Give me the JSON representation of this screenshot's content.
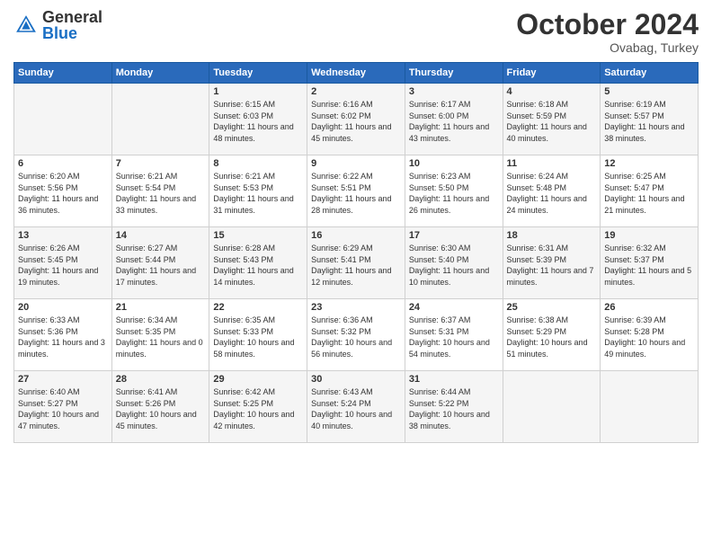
{
  "header": {
    "logo": "GeneralBlue",
    "month": "October 2024",
    "location": "Ovabag, Turkey"
  },
  "weekdays": [
    "Sunday",
    "Monday",
    "Tuesday",
    "Wednesday",
    "Thursday",
    "Friday",
    "Saturday"
  ],
  "weeks": [
    [
      {
        "day": "",
        "sunrise": "",
        "sunset": "",
        "daylight": ""
      },
      {
        "day": "",
        "sunrise": "",
        "sunset": "",
        "daylight": ""
      },
      {
        "day": "1",
        "sunrise": "Sunrise: 6:15 AM",
        "sunset": "Sunset: 6:03 PM",
        "daylight": "Daylight: 11 hours and 48 minutes."
      },
      {
        "day": "2",
        "sunrise": "Sunrise: 6:16 AM",
        "sunset": "Sunset: 6:02 PM",
        "daylight": "Daylight: 11 hours and 45 minutes."
      },
      {
        "day": "3",
        "sunrise": "Sunrise: 6:17 AM",
        "sunset": "Sunset: 6:00 PM",
        "daylight": "Daylight: 11 hours and 43 minutes."
      },
      {
        "day": "4",
        "sunrise": "Sunrise: 6:18 AM",
        "sunset": "Sunset: 5:59 PM",
        "daylight": "Daylight: 11 hours and 40 minutes."
      },
      {
        "day": "5",
        "sunrise": "Sunrise: 6:19 AM",
        "sunset": "Sunset: 5:57 PM",
        "daylight": "Daylight: 11 hours and 38 minutes."
      }
    ],
    [
      {
        "day": "6",
        "sunrise": "Sunrise: 6:20 AM",
        "sunset": "Sunset: 5:56 PM",
        "daylight": "Daylight: 11 hours and 36 minutes."
      },
      {
        "day": "7",
        "sunrise": "Sunrise: 6:21 AM",
        "sunset": "Sunset: 5:54 PM",
        "daylight": "Daylight: 11 hours and 33 minutes."
      },
      {
        "day": "8",
        "sunrise": "Sunrise: 6:21 AM",
        "sunset": "Sunset: 5:53 PM",
        "daylight": "Daylight: 11 hours and 31 minutes."
      },
      {
        "day": "9",
        "sunrise": "Sunrise: 6:22 AM",
        "sunset": "Sunset: 5:51 PM",
        "daylight": "Daylight: 11 hours and 28 minutes."
      },
      {
        "day": "10",
        "sunrise": "Sunrise: 6:23 AM",
        "sunset": "Sunset: 5:50 PM",
        "daylight": "Daylight: 11 hours and 26 minutes."
      },
      {
        "day": "11",
        "sunrise": "Sunrise: 6:24 AM",
        "sunset": "Sunset: 5:48 PM",
        "daylight": "Daylight: 11 hours and 24 minutes."
      },
      {
        "day": "12",
        "sunrise": "Sunrise: 6:25 AM",
        "sunset": "Sunset: 5:47 PM",
        "daylight": "Daylight: 11 hours and 21 minutes."
      }
    ],
    [
      {
        "day": "13",
        "sunrise": "Sunrise: 6:26 AM",
        "sunset": "Sunset: 5:45 PM",
        "daylight": "Daylight: 11 hours and 19 minutes."
      },
      {
        "day": "14",
        "sunrise": "Sunrise: 6:27 AM",
        "sunset": "Sunset: 5:44 PM",
        "daylight": "Daylight: 11 hours and 17 minutes."
      },
      {
        "day": "15",
        "sunrise": "Sunrise: 6:28 AM",
        "sunset": "Sunset: 5:43 PM",
        "daylight": "Daylight: 11 hours and 14 minutes."
      },
      {
        "day": "16",
        "sunrise": "Sunrise: 6:29 AM",
        "sunset": "Sunset: 5:41 PM",
        "daylight": "Daylight: 11 hours and 12 minutes."
      },
      {
        "day": "17",
        "sunrise": "Sunrise: 6:30 AM",
        "sunset": "Sunset: 5:40 PM",
        "daylight": "Daylight: 11 hours and 10 minutes."
      },
      {
        "day": "18",
        "sunrise": "Sunrise: 6:31 AM",
        "sunset": "Sunset: 5:39 PM",
        "daylight": "Daylight: 11 hours and 7 minutes."
      },
      {
        "day": "19",
        "sunrise": "Sunrise: 6:32 AM",
        "sunset": "Sunset: 5:37 PM",
        "daylight": "Daylight: 11 hours and 5 minutes."
      }
    ],
    [
      {
        "day": "20",
        "sunrise": "Sunrise: 6:33 AM",
        "sunset": "Sunset: 5:36 PM",
        "daylight": "Daylight: 11 hours and 3 minutes."
      },
      {
        "day": "21",
        "sunrise": "Sunrise: 6:34 AM",
        "sunset": "Sunset: 5:35 PM",
        "daylight": "Daylight: 11 hours and 0 minutes."
      },
      {
        "day": "22",
        "sunrise": "Sunrise: 6:35 AM",
        "sunset": "Sunset: 5:33 PM",
        "daylight": "Daylight: 10 hours and 58 minutes."
      },
      {
        "day": "23",
        "sunrise": "Sunrise: 6:36 AM",
        "sunset": "Sunset: 5:32 PM",
        "daylight": "Daylight: 10 hours and 56 minutes."
      },
      {
        "day": "24",
        "sunrise": "Sunrise: 6:37 AM",
        "sunset": "Sunset: 5:31 PM",
        "daylight": "Daylight: 10 hours and 54 minutes."
      },
      {
        "day": "25",
        "sunrise": "Sunrise: 6:38 AM",
        "sunset": "Sunset: 5:29 PM",
        "daylight": "Daylight: 10 hours and 51 minutes."
      },
      {
        "day": "26",
        "sunrise": "Sunrise: 6:39 AM",
        "sunset": "Sunset: 5:28 PM",
        "daylight": "Daylight: 10 hours and 49 minutes."
      }
    ],
    [
      {
        "day": "27",
        "sunrise": "Sunrise: 6:40 AM",
        "sunset": "Sunset: 5:27 PM",
        "daylight": "Daylight: 10 hours and 47 minutes."
      },
      {
        "day": "28",
        "sunrise": "Sunrise: 6:41 AM",
        "sunset": "Sunset: 5:26 PM",
        "daylight": "Daylight: 10 hours and 45 minutes."
      },
      {
        "day": "29",
        "sunrise": "Sunrise: 6:42 AM",
        "sunset": "Sunset: 5:25 PM",
        "daylight": "Daylight: 10 hours and 42 minutes."
      },
      {
        "day": "30",
        "sunrise": "Sunrise: 6:43 AM",
        "sunset": "Sunset: 5:24 PM",
        "daylight": "Daylight: 10 hours and 40 minutes."
      },
      {
        "day": "31",
        "sunrise": "Sunrise: 6:44 AM",
        "sunset": "Sunset: 5:22 PM",
        "daylight": "Daylight: 10 hours and 38 minutes."
      },
      {
        "day": "",
        "sunrise": "",
        "sunset": "",
        "daylight": ""
      },
      {
        "day": "",
        "sunrise": "",
        "sunset": "",
        "daylight": ""
      }
    ]
  ]
}
